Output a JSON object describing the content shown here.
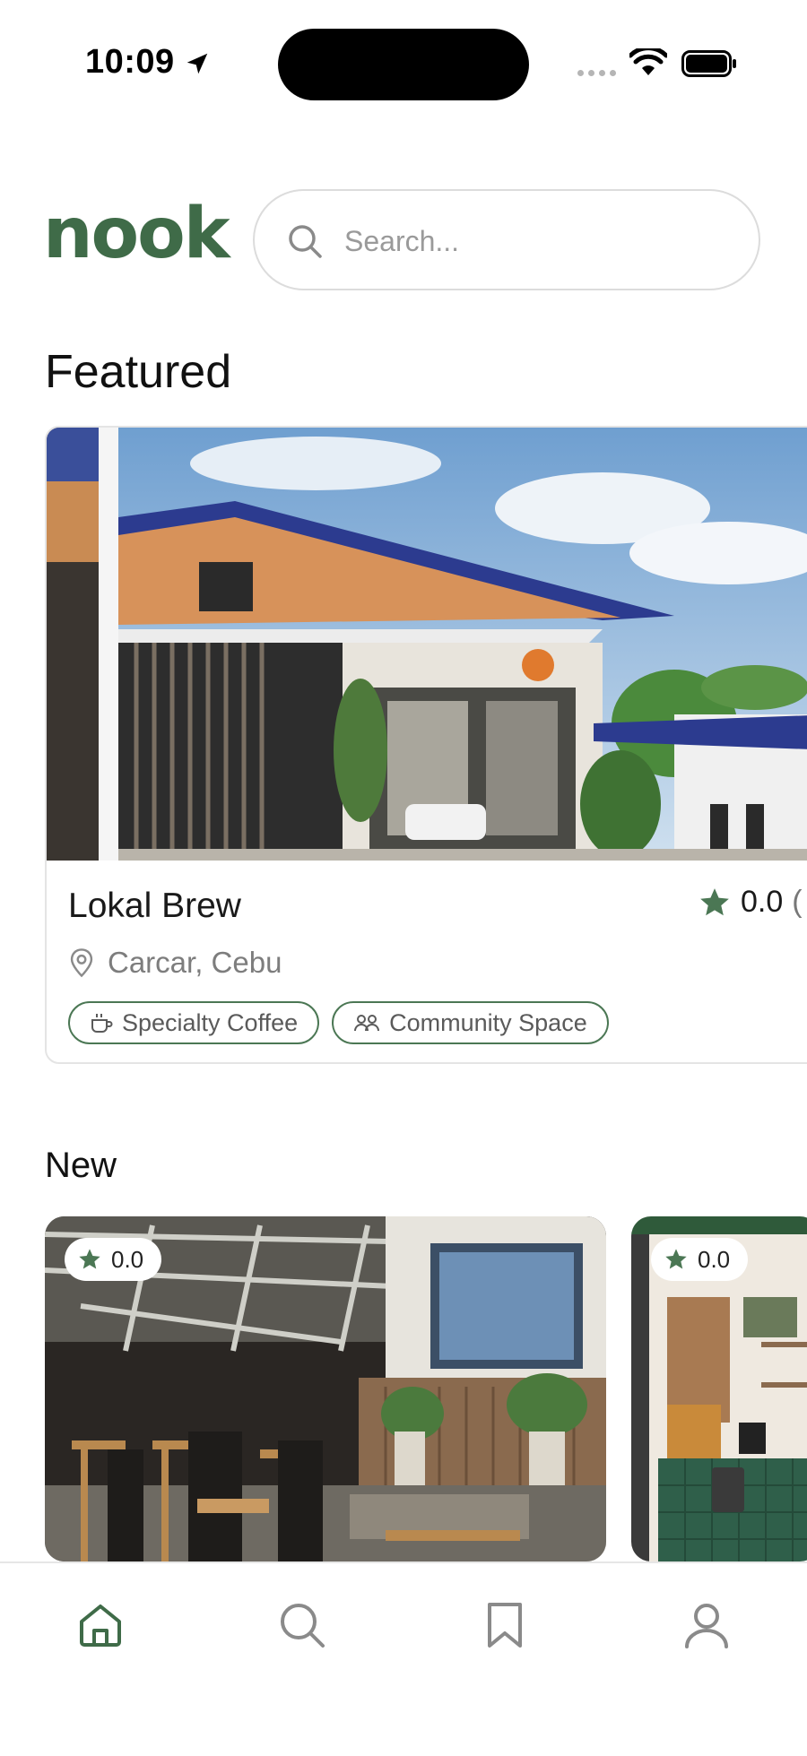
{
  "status_bar": {
    "time": "10:09"
  },
  "header": {
    "logo": "nook",
    "search_placeholder": "Search..."
  },
  "featured": {
    "heading": "Featured",
    "card": {
      "title": "Lokal Brew",
      "rating": "0.0",
      "rating_suffix": "(",
      "location": "Carcar, Cebu",
      "tags": [
        "Specialty Coffee",
        "Community Space"
      ]
    }
  },
  "new_section": {
    "heading": "New",
    "cards": [
      {
        "rating": "0.0"
      },
      {
        "rating": "0.0"
      }
    ]
  },
  "colors": {
    "brand_green": "#3f6b48",
    "star_green": "#4b7754"
  },
  "nav": {
    "items": [
      "home-icon",
      "search-icon",
      "bookmark-icon",
      "profile-icon"
    ],
    "active": "home-icon"
  }
}
